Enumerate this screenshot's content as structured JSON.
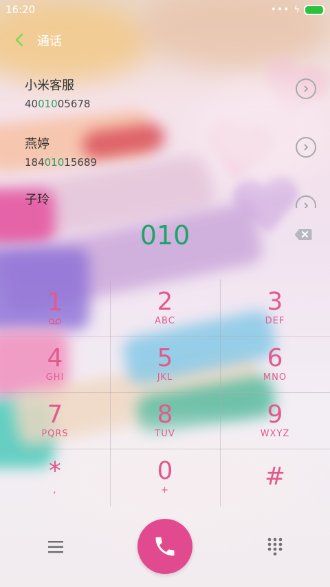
{
  "status_bar": {
    "time": "16:20",
    "dots": "•••",
    "bolt": "ϟ"
  },
  "header": {
    "title": "通话"
  },
  "contacts": [
    {
      "name": "小米客服",
      "number_pre": "40",
      "number_hl": "010",
      "number_post": "05678"
    },
    {
      "name": "燕婷",
      "number_pre": "184",
      "number_hl": "010",
      "number_post": "15689"
    },
    {
      "name": "子玲"
    }
  ],
  "dial": {
    "number": "010"
  },
  "keys": [
    {
      "digit": "1",
      "letters": ""
    },
    {
      "digit": "2",
      "letters": "ABC"
    },
    {
      "digit": "3",
      "letters": "DEF"
    },
    {
      "digit": "4",
      "letters": "GHI"
    },
    {
      "digit": "5",
      "letters": "JKL"
    },
    {
      "digit": "6",
      "letters": "MNO"
    },
    {
      "digit": "7",
      "letters": "PQRS"
    },
    {
      "digit": "8",
      "letters": "TUV"
    },
    {
      "digit": "9",
      "letters": "WXYZ"
    },
    {
      "digit": "*",
      "letters": ","
    },
    {
      "digit": "0",
      "letters": "+"
    },
    {
      "digit": "#",
      "letters": ""
    }
  ],
  "colors": {
    "accent": "#e25a8c",
    "call": "#e14a8f",
    "highlight": "#2a9d63",
    "battery": "#2ac43b"
  },
  "icons": [
    "back-icon",
    "chevron-right-icon",
    "backspace-icon",
    "voicemail-icon",
    "menu-icon",
    "phone-icon",
    "dialpad-icon"
  ]
}
